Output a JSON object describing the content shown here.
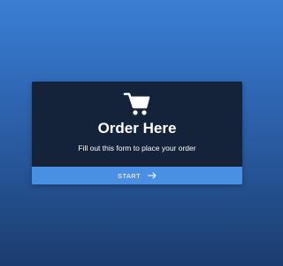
{
  "card": {
    "icon": "shopping-cart-icon",
    "title": "Order Here",
    "subtitle": "Fill out this form to place your order",
    "start_label": "START",
    "start_icon": "arrow-right-icon"
  },
  "colors": {
    "background_top": "#3a7fd4",
    "background_bottom": "#1b3c6d",
    "card_background": "#14233a",
    "button_background": "#4a90e2",
    "text": "#ffffff"
  }
}
